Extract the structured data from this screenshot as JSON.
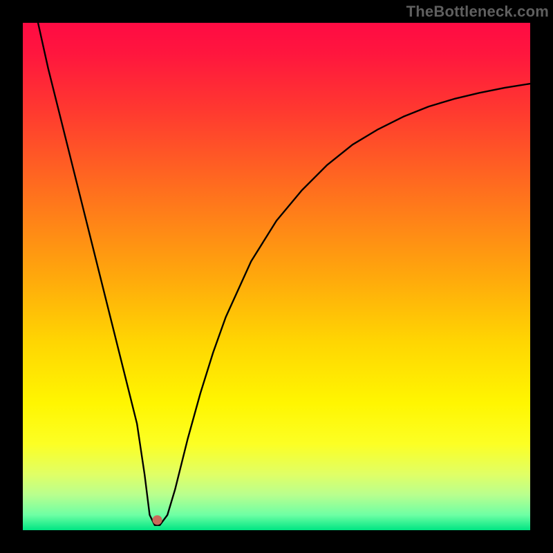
{
  "watermark": "TheBottleneck.com",
  "chart_data": {
    "type": "line",
    "title": "",
    "xlabel": "",
    "ylabel": "",
    "xlim": [
      0,
      100
    ],
    "ylim": [
      0,
      100
    ],
    "series": [
      {
        "name": "bottleneck-curve",
        "x": [
          3,
          5,
          7.5,
          10,
          12.5,
          15,
          17.5,
          20,
          22.5,
          24,
          25,
          26,
          27,
          28.5,
          30,
          32.5,
          35,
          37.5,
          40,
          45,
          50,
          55,
          60,
          65,
          70,
          75,
          80,
          85,
          90,
          95,
          100
        ],
        "values": [
          100,
          91,
          81,
          71,
          61,
          51,
          41,
          31,
          21,
          11,
          3,
          1,
          1,
          3,
          8,
          18,
          27,
          35,
          42,
          53,
          61,
          67,
          72,
          76,
          79,
          81.5,
          83.5,
          85,
          86.2,
          87.2,
          88
        ]
      }
    ],
    "marker": {
      "x": 26.5,
      "y": 2,
      "color": "#c96a5a",
      "size": 14
    },
    "background_gradient": {
      "top": "#ff0b43",
      "mid1": "#ffa80c",
      "mid2": "#fff601",
      "bottom": "#00e583"
    },
    "frame_color": "#000000"
  }
}
